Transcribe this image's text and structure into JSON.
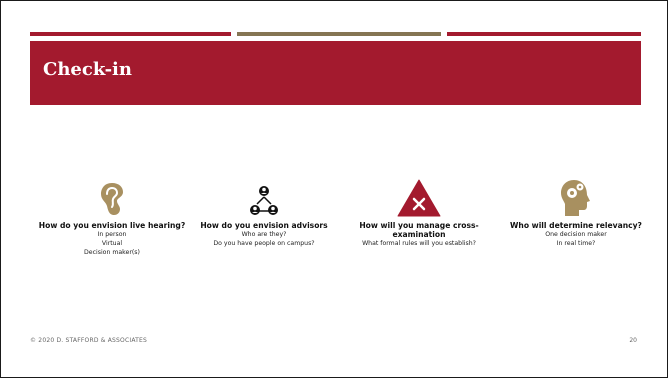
{
  "slide": {
    "title": "Check-in",
    "footer": "© 2020 D. STAFFORD & ASSOCIATES",
    "page_number": "20"
  },
  "cards": [
    {
      "icon": "ear-icon",
      "question": "How do you envision live hearing?",
      "lines": [
        "In person",
        "Virtual",
        "Decision maker(s)"
      ]
    },
    {
      "icon": "people-network-icon",
      "question": "How do you envision advisors",
      "lines": [
        "Who are they?",
        "Do you have people on campus?"
      ]
    },
    {
      "icon": "warning-x-icon",
      "question": "How will you manage cross-examination",
      "lines": [
        "What formal rules will you establish?"
      ]
    },
    {
      "icon": "head-gears-icon",
      "question": "Who will determine relevancy?",
      "lines": [
        "One decision maker",
        "In real time?"
      ]
    }
  ],
  "colors": {
    "accent": "#a31a2e",
    "gold": "#857553",
    "icon_gold": "#a89060"
  }
}
